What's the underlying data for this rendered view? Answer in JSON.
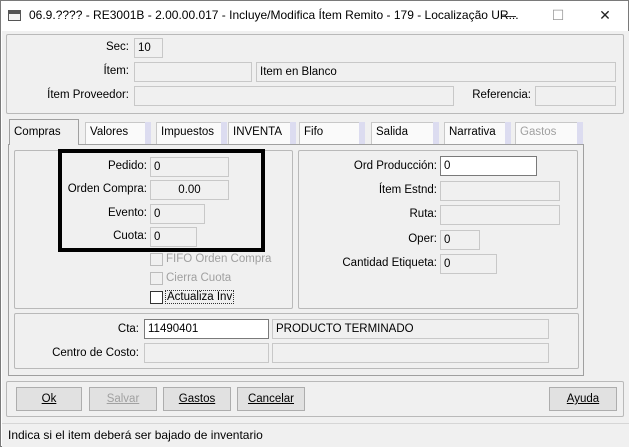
{
  "window": {
    "title": "06.9.???? - RE3001B - 2.00.00.017 - Incluye/Modifica Ítem Remito - 179 - Localização UR...",
    "minimize": "—",
    "maximize": "☐",
    "close": "✕"
  },
  "header": {
    "sec_label": "Sec:",
    "sec_value": "10",
    "item_label": "Ítem:",
    "item_code": "",
    "item_desc": "Item en Blanco",
    "proveedor_label": "Ítem Proveedor:",
    "proveedor_value": "",
    "referencia_label": "Referencia:",
    "referencia_value": ""
  },
  "tabs": [
    {
      "label": "Compras",
      "active": true,
      "disabled": false
    },
    {
      "label": "Valores",
      "active": false,
      "disabled": false
    },
    {
      "label": "Impuestos",
      "active": false,
      "disabled": false
    },
    {
      "label": "INVENTA",
      "active": false,
      "disabled": false
    },
    {
      "label": "Fifo",
      "active": false,
      "disabled": false
    },
    {
      "label": "Salida",
      "active": false,
      "disabled": false
    },
    {
      "label": "Narrativa",
      "active": false,
      "disabled": false
    },
    {
      "label": "Gastos",
      "active": false,
      "disabled": true
    }
  ],
  "compras": {
    "pedido_label": "Pedido:",
    "pedido_value": "0",
    "orden_compra_label": "Orden Compra:",
    "orden_compra_value": "0.00",
    "evento_label": "Evento:",
    "evento_value": "0",
    "cuota_label": "Cuota:",
    "cuota_value": "0",
    "fifo_orden_compra_label": "FIFO Orden Compra",
    "cierra_cuota_label": "Cierra Cuota",
    "actualiza_inv_label": "Actualiza Inv",
    "ord_produccion_label": "Ord Producción:",
    "ord_produccion_value": "0",
    "item_estnd_label": "Ítem Estnd:",
    "item_estnd_value": "",
    "ruta_label": "Ruta:",
    "ruta_value": "",
    "oper_label": "Oper:",
    "oper_value": "0",
    "cantidad_etiqueta_label": "Cantidad Etiqueta:",
    "cantidad_etiqueta_value": "0",
    "cta_label": "Cta:",
    "cta_value": "11490401",
    "cta_desc": "PRODUCTO TERMINADO",
    "centro_costo_label": "Centro de Costo:",
    "centro_costo_value": "",
    "centro_costo_desc": ""
  },
  "buttons": {
    "ok": "Ok",
    "salvar": "Salvar",
    "gastos": "Gastos",
    "cancelar": "Cancelar",
    "ayuda": "Ayuda"
  },
  "status": "Indica si el item deberá ser bajado de inventario"
}
